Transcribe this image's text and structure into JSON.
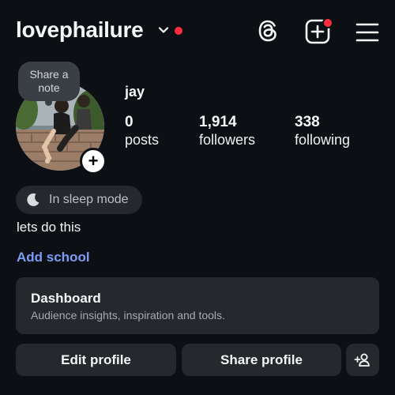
{
  "header": {
    "username": "lovephailure"
  },
  "profile": {
    "note_bubble": "Share a note",
    "display_name": "jay",
    "stats": [
      {
        "value": "0",
        "label": "posts"
      },
      {
        "value": "1,914",
        "label": "followers"
      },
      {
        "value": "338",
        "label": "following"
      }
    ],
    "status_pill": "In sleep mode",
    "bio": "lets do this",
    "add_school": "Add school"
  },
  "dashboard": {
    "title": "Dashboard",
    "subtitle": "Audience insights, inspiration and tools."
  },
  "actions": {
    "edit_profile": "Edit profile",
    "share_profile": "Share profile"
  },
  "icons": {
    "username_chevron": "chevron-down-icon",
    "notification_dot": "red-dot",
    "threads": "threads-icon",
    "create": "plus-square-icon",
    "menu": "hamburger-menu-icon",
    "story_add": "plus-icon",
    "sleep": "moon-icon",
    "discover_people": "add-person-icon"
  },
  "colors": {
    "background": "#0c1014",
    "surface": "#25292e",
    "accent_link": "#7d9cf5",
    "notification": "#ff2d3d"
  }
}
